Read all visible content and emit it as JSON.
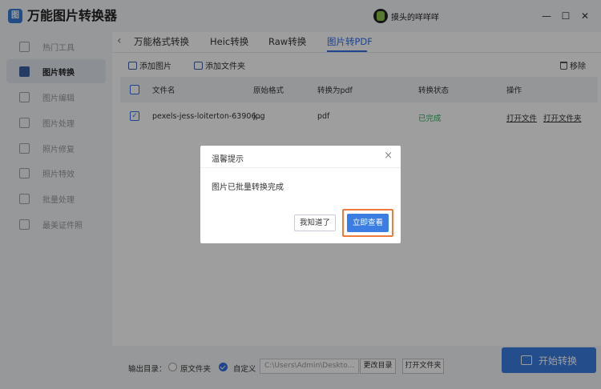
{
  "app": {
    "title": "万能图片转换器",
    "logo_text": "图",
    "user_name": "摸头的咩咩咩"
  },
  "window_controls": {
    "minimize": "—",
    "maximize": "☐",
    "close": "✕"
  },
  "sidebar": {
    "items": [
      {
        "label": "热门工具",
        "active": false
      },
      {
        "label": "图片转换",
        "active": true
      },
      {
        "label": "图片编辑",
        "active": false
      },
      {
        "label": "图片处理",
        "active": false
      },
      {
        "label": "照片修复",
        "active": false
      },
      {
        "label": "照片特效",
        "active": false
      },
      {
        "label": "批量处理",
        "active": false
      },
      {
        "label": "最美证件照",
        "active": false
      }
    ]
  },
  "tabs": [
    {
      "label": "万能格式转换",
      "active": false
    },
    {
      "label": "Heic转换",
      "active": false
    },
    {
      "label": "Raw转换",
      "active": false
    },
    {
      "label": "图片转PDF",
      "active": true
    }
  ],
  "toolbar": {
    "add_image": "添加图片",
    "add_folder": "添加文件夹",
    "remove": "移除"
  },
  "table": {
    "columns": [
      "文件名",
      "原始格式",
      "转换为pdf",
      "转换状态",
      "操作"
    ],
    "rows": [
      {
        "checked": true,
        "filename": "pexels-jess-loiterton-63906...",
        "format": "jpg",
        "target": "pdf",
        "status": "已完成",
        "action_open_file": "打开文件",
        "action_open_folder": "打开文件夹"
      }
    ]
  },
  "footer": {
    "output_label": "输出目录：",
    "radio_original": "原文件夹",
    "radio_custom": "自定义",
    "selected": "custom",
    "path_value": "C:\\Users\\Admin\\Deskto...",
    "change_dir": "更改目录",
    "open_folder": "打开文件夹",
    "start": "开始转换"
  },
  "dialog": {
    "title": "温馨提示",
    "message": "图片已批量转换完成",
    "btn_ok": "我知道了",
    "btn_view": "立即查看",
    "highlight_color": "#f07a3c"
  },
  "colors": {
    "accent": "#2f6fe4",
    "success": "#2eb05c"
  }
}
